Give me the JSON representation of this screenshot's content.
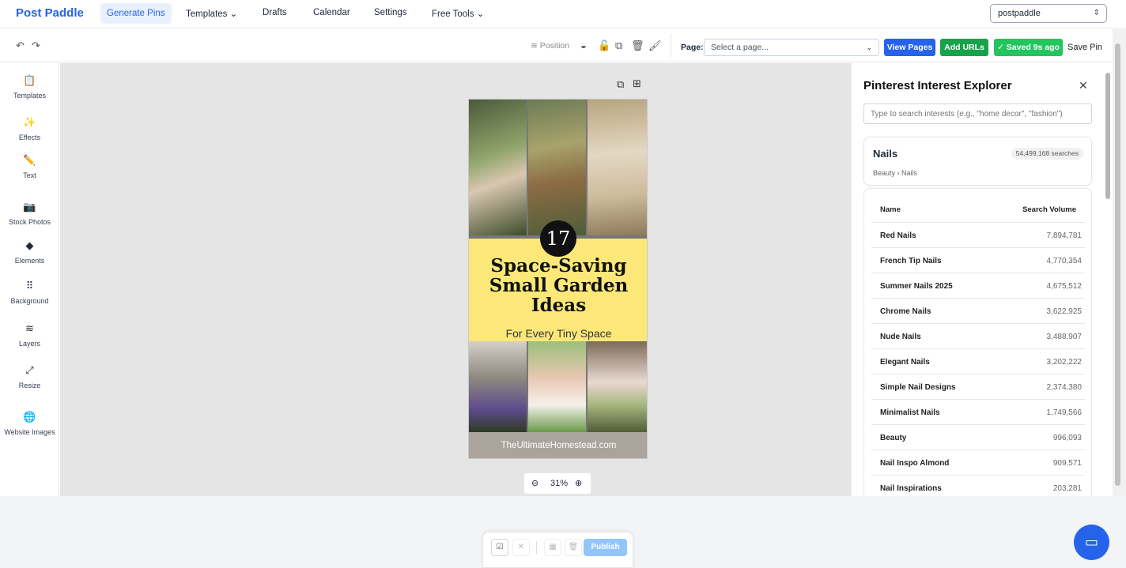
{
  "nav": {
    "brand": "Post Paddle",
    "items": [
      "Generate Pins",
      "Templates",
      "Drafts",
      "Calendar",
      "Settings",
      "Free Tools"
    ],
    "account": "postpaddle"
  },
  "toolbar": {
    "position": "Position",
    "page_label": "Page:",
    "page_placeholder": "Select a page...",
    "view_pages": "View Pages",
    "add_urls": "Add URLs",
    "saved": "✓ Saved 9s ago",
    "save_pin": "Save Pin"
  },
  "sidebar": {
    "items": [
      {
        "label": "Templates",
        "icon": "📋"
      },
      {
        "label": "Effects",
        "icon": "✨"
      },
      {
        "label": "Text",
        "icon": "✏️"
      },
      {
        "label": "Stock Photos",
        "icon": "📷"
      },
      {
        "label": "Elements",
        "icon": "◆"
      },
      {
        "label": "Background",
        "icon": "⠿"
      },
      {
        "label": "Layers",
        "icon": "≋"
      },
      {
        "label": "Resize",
        "icon": "⤢"
      },
      {
        "label": "Website Images",
        "icon": "🌐"
      }
    ]
  },
  "pin": {
    "number": "17",
    "title": "Space-Saving Small Garden Ideas",
    "subtitle": "For Every Tiny Space",
    "footer": "TheUltimateHomestead.com"
  },
  "zoom": {
    "level": "31%"
  },
  "explorer": {
    "title": "Pinterest Interest Explorer",
    "search_placeholder": "Type to search interests (e.g., \"home decor\", \"fashion\")",
    "interest": {
      "name": "Nails",
      "searches": "54,499,168 searches",
      "breadcrumb": "Beauty › Nails"
    },
    "columns": [
      "Name",
      "Search Volume"
    ],
    "rows": [
      {
        "name": "Red Nails",
        "volume": "7,894,781"
      },
      {
        "name": "French Tip Nails",
        "volume": "4,770,354"
      },
      {
        "name": "Summer Nails 2025",
        "volume": "4,675,512"
      },
      {
        "name": "Chrome Nails",
        "volume": "3,622,925"
      },
      {
        "name": "Nude Nails",
        "volume": "3,488,907"
      },
      {
        "name": "Elegant Nails",
        "volume": "3,202,222"
      },
      {
        "name": "Simple Nail Designs",
        "volume": "2,374,380"
      },
      {
        "name": "Minimalist Nails",
        "volume": "1,749,566"
      },
      {
        "name": "Beauty",
        "volume": "996,093"
      },
      {
        "name": "Nail Inspo Almond",
        "volume": "909,571"
      },
      {
        "name": "Nail Inspirations",
        "volume": "203,281"
      }
    ]
  },
  "publish_bar": {
    "publish": "Publish"
  },
  "colors": {
    "brand": "#2563eb",
    "view_pages": "#2563eb",
    "add_urls": "#16a34a",
    "saved": "#22c55e",
    "pin_band": "#fbe878"
  }
}
